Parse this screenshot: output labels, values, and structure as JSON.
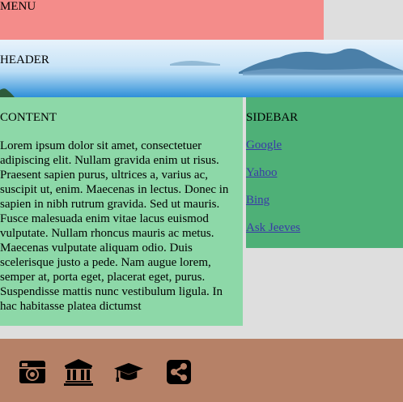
{
  "menu": {
    "label": "MENU"
  },
  "header": {
    "label": "HEADER"
  },
  "content": {
    "heading": "CONTENT",
    "body": "Lorem ipsum dolor sit amet, consectetuer adipiscing elit. Nullam gravida enim ut risus. Praesent sapien purus, ultrices a, varius ac, suscipit ut, enim. Maecenas in lectus. Donec in sapien in nibh rutrum gravida. Sed ut mauris. Fusce malesuada enim vitae lacus euismod vulputate. Nullam rhoncus mauris ac metus. Maecenas vulputate aliquam odio. Duis scelerisque justo a pede. Nam augue lorem, semper at, porta eget, placerat eget, purus. Suspendisse mattis nunc vestibulum ligula. In hac habitasse platea dictumst"
  },
  "sidebar": {
    "heading": "SIDEBAR",
    "links": [
      {
        "label": "Google"
      },
      {
        "label": "Yahoo"
      },
      {
        "label": "Bing"
      },
      {
        "label": "Ask Jeeves"
      }
    ]
  },
  "footer": {
    "icons": [
      "camera-icon",
      "institution-icon",
      "graduation-cap-icon",
      "share-icon"
    ]
  },
  "colors": {
    "menu_bg": "#f48c8a",
    "content_bg": "#8dd8a8",
    "sidebar_bg": "#4eb077",
    "footer_bg": "#b68167",
    "page_bg": "#dedede",
    "link": "#3a3aa8"
  }
}
